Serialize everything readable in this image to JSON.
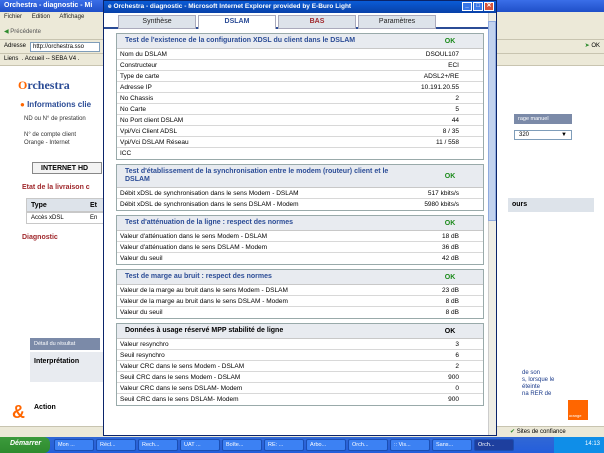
{
  "background_window": {
    "title": "Orchestra - diagnostic - Mi",
    "menu": [
      "Fichier",
      "Edition",
      "Affichage"
    ],
    "back_label": "Précédente",
    "address_label": "Adresse",
    "address_value": "http://orchestra.sso",
    "go_label": "OK",
    "links_label": "Liens",
    "links_item": ". Accueil -- SEBA V4 .",
    "logo_o": "O",
    "logo_text": "rchestra",
    "info_title": "Informations clie",
    "info_lines": [
      "ND ou N° de prestation",
      "N° de compte client",
      "Orange - Internet"
    ],
    "hd_tab": "INTERNET HD",
    "etat_title": "Etat de la livraison c",
    "table_header": "Type",
    "table_header_2": "Et",
    "table_cell": "Accès xDSL",
    "table_cell_2": "En",
    "diagnostic_title": "Diagnostic",
    "detail_button": "Détail du résultat",
    "interpretation": "Interprétation",
    "action": "Action",
    "right_manual": "rage manuel",
    "right_select": "320",
    "right_hours": "ours",
    "right_note": [
      "de son",
      "s, lorsque le",
      "éteinte",
      "na RER de"
    ],
    "orange_square": "orange",
    "status_zone": "Sites de confiance",
    "orange_ampersand": "&"
  },
  "popup": {
    "title": "Orchestra - diagnostic - Microsoft Internet Explorer provided by E-Buro Light",
    "tabs": [
      {
        "label": "Synthèse"
      },
      {
        "label": "DSLAM"
      },
      {
        "label": "BAS"
      },
      {
        "label": "Paramètres"
      }
    ],
    "sections": [
      {
        "title": "Test de l'existence de la configuration XDSL du client dans le DSLAM",
        "status": "OK",
        "rows": [
          {
            "label": "Nom du DSLAM",
            "value": "DSOUL107"
          },
          {
            "label": "Constructeur",
            "value": "ECI"
          },
          {
            "label": "Type de carte",
            "value": "ADSL2+/RE"
          },
          {
            "label": "Adresse IP",
            "value": "10.191.20.55"
          },
          {
            "label": "No Chassis",
            "value": "2"
          },
          {
            "label": "No Carte",
            "value": "5"
          },
          {
            "label": "No Port client DSLAM",
            "value": "44"
          },
          {
            "label": "Vpi/Vci Client ADSL",
            "value": "8 / 35"
          },
          {
            "label": "Vpi/Vci DSLAM Réseau",
            "value": "11 / 558"
          },
          {
            "label": "ICC",
            "value": ""
          }
        ]
      },
      {
        "title": "Test d'établissement de la synchronisation entre le modem (routeur) client et le DSLAM",
        "status": "OK",
        "rows": [
          {
            "label": "Débit xDSL de synchronisation dans le sens Modem - DSLAM",
            "value": "517 kbits/s"
          },
          {
            "label": "Débit xDSL de synchronisation dans le sens DSLAM - Modem",
            "value": "5980 kbits/s"
          }
        ]
      },
      {
        "title": "Test d'atténuation de la ligne : respect des normes",
        "status": "OK",
        "rows": [
          {
            "label": "Valeur d'atténuation dans le sens Modem - DSLAM",
            "value": "18 dB"
          },
          {
            "label": "Valeur d'atténuation dans le sens DSLAM - Modem",
            "value": "36 dB"
          },
          {
            "label": "Valeur du seuil",
            "value": "42 dB"
          }
        ]
      },
      {
        "title": "Test de marge au bruit : respect des normes",
        "status": "OK",
        "rows": [
          {
            "label": "Valeur de la marge au bruit dans le sens Modem - DSLAM",
            "value": "23 dB"
          },
          {
            "label": "Valeur de la marge au bruit dans le sens DSLAM - Modem",
            "value": "8 dB"
          },
          {
            "label": "Valeur du seuil",
            "value": "8 dB"
          }
        ]
      },
      {
        "title": "Données à usage réservé MPP stabilité de ligne",
        "status": "OK",
        "rows": [
          {
            "label": "Valeur resynchro",
            "value": "3"
          },
          {
            "label": "Seuil resynchro",
            "value": "6"
          },
          {
            "label": "Valeur CRC dans le sens Modem - DSLAM",
            "value": "2"
          },
          {
            "label": "Seuil CRC dans le sens Modem - DSLAM",
            "value": "900"
          },
          {
            "label": "Valeur CRC dans le sens DSLAM- Modem",
            "value": "0"
          },
          {
            "label": "Seuil CRC dans le sens DSLAM- Modem",
            "value": "900"
          }
        ]
      }
    ]
  },
  "taskbar": {
    "start": "Démarrer",
    "tasks": [
      "Mon ...",
      "Récl...",
      "Rech...",
      "UAT ...",
      "Boîte...",
      "RE: ...",
      "Arbo...",
      "Orch...",
      ":: Vis...",
      "Sans...",
      "Orch..."
    ],
    "clock": "14:13"
  }
}
